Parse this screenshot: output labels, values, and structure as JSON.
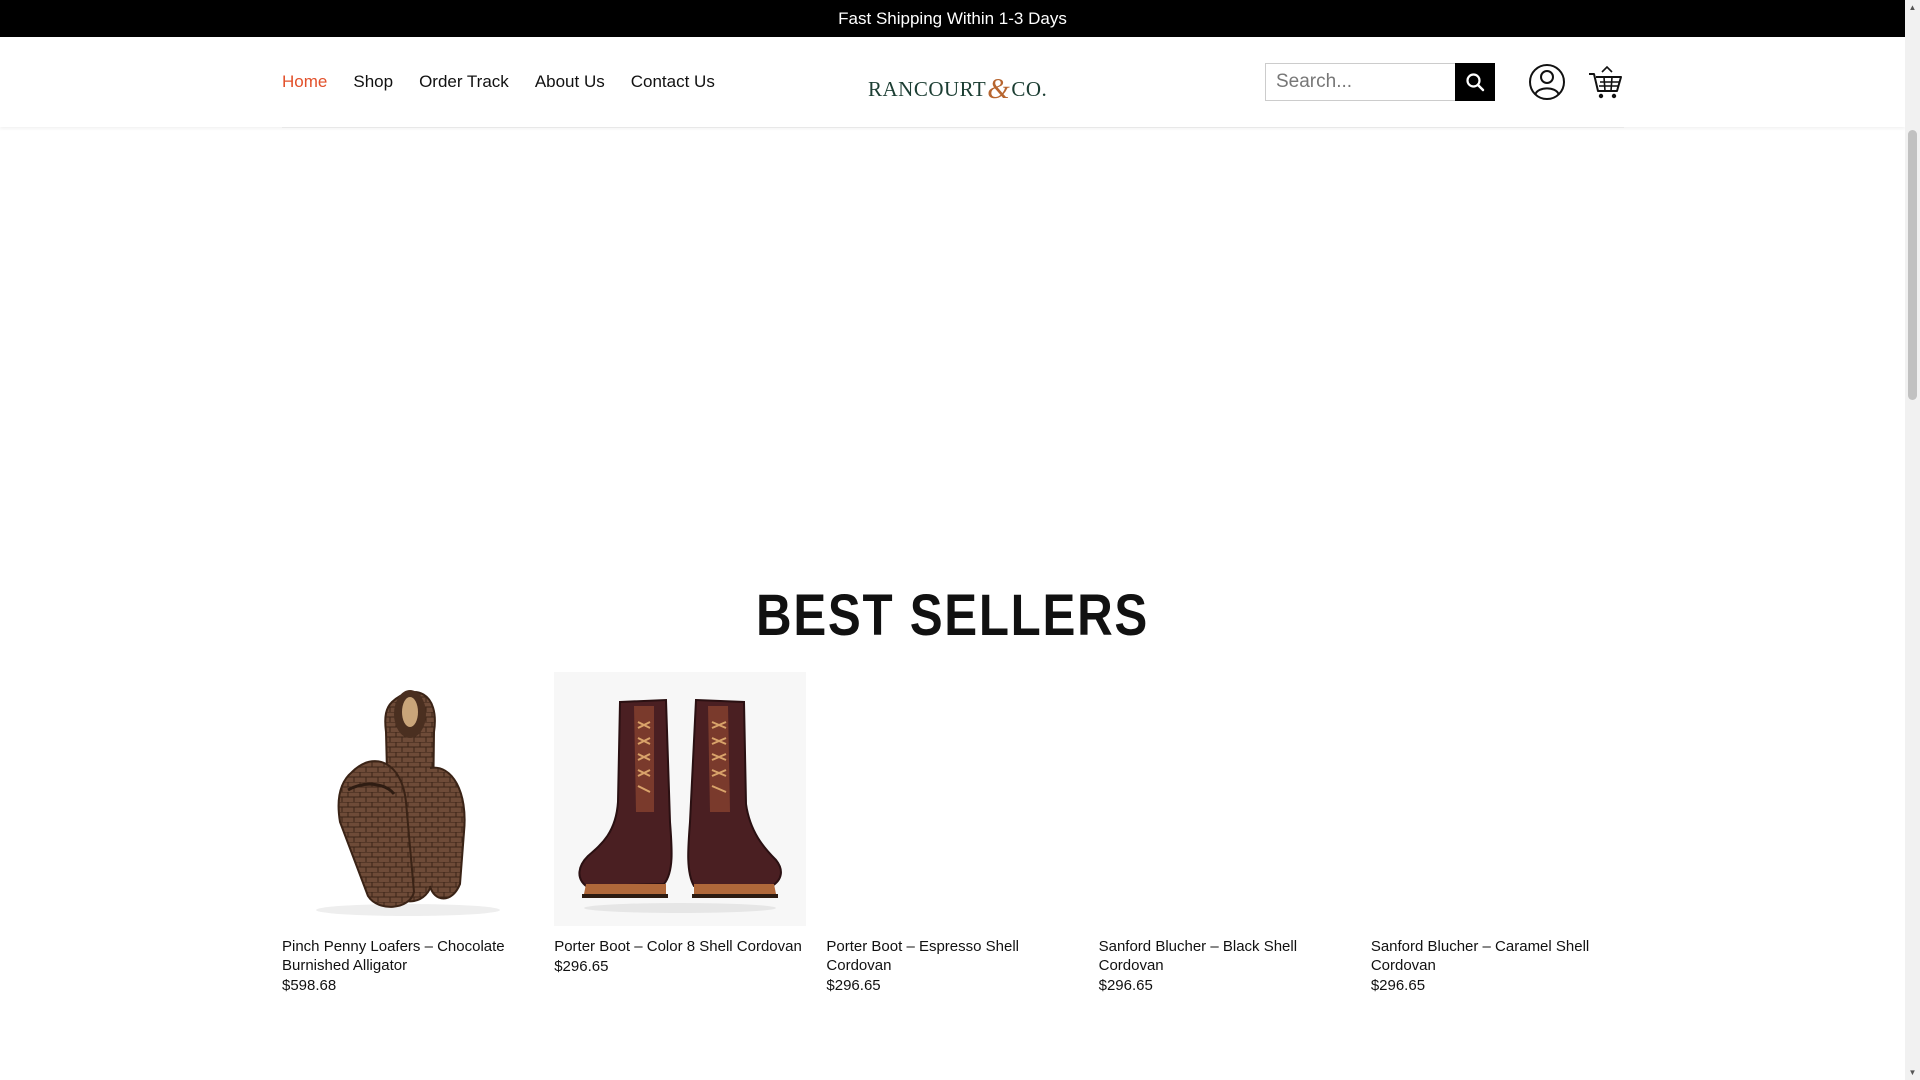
{
  "announcement": "Fast Shipping Within 1-3 Days",
  "nav": [
    "Home",
    "Shop",
    "Order Track",
    "About Us",
    "Contact Us"
  ],
  "logo": {
    "part1": "RANCOURT",
    "amp": "&",
    "part2": "CO."
  },
  "search": {
    "placeholder": "Search..."
  },
  "icons": {
    "search": "search-icon",
    "account": "user-icon",
    "cart": "cart-icon"
  },
  "section_title": "BEST SELLERS",
  "products": [
    {
      "name": "Pinch Penny Loafers – Chocolate Burnished Alligator",
      "price": "$598.68"
    },
    {
      "name": "Porter Boot – Color 8 Shell Cordovan",
      "price": "$296.65"
    },
    {
      "name": "Porter Boot – Espresso Shell Cordovan",
      "price": "$296.65"
    },
    {
      "name": "Sanford Blucher – Black Shell Cordovan",
      "price": "$296.65"
    },
    {
      "name": "Sanford Blucher – Caramel Shell Cordovan",
      "price": "$296.65"
    }
  ],
  "colors": {
    "accent": "#e2502a",
    "logo_green": "#1c3e33",
    "logo_amp": "#b7652f",
    "topbar": "#000000"
  }
}
